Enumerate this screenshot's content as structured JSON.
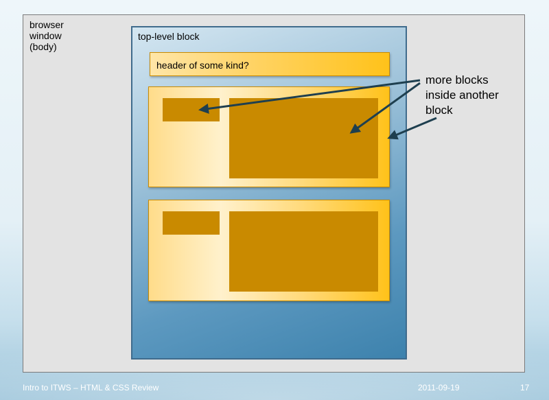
{
  "browser": {
    "label_lines": [
      "browser",
      "window",
      "(body)"
    ]
  },
  "top_block": {
    "label": "top-level block"
  },
  "header_block": {
    "label": "header of some kind?"
  },
  "annotation": {
    "lines": [
      "more blocks",
      "inside another",
      "block"
    ]
  },
  "footer": {
    "title": "Intro to ITWS – HTML & CSS Review",
    "date": "2011-09-19",
    "page": "17"
  },
  "colors": {
    "inner_block": "#c98a00",
    "top_block_border": "#3f6b8c",
    "arrow": "#1e3f4f"
  }
}
